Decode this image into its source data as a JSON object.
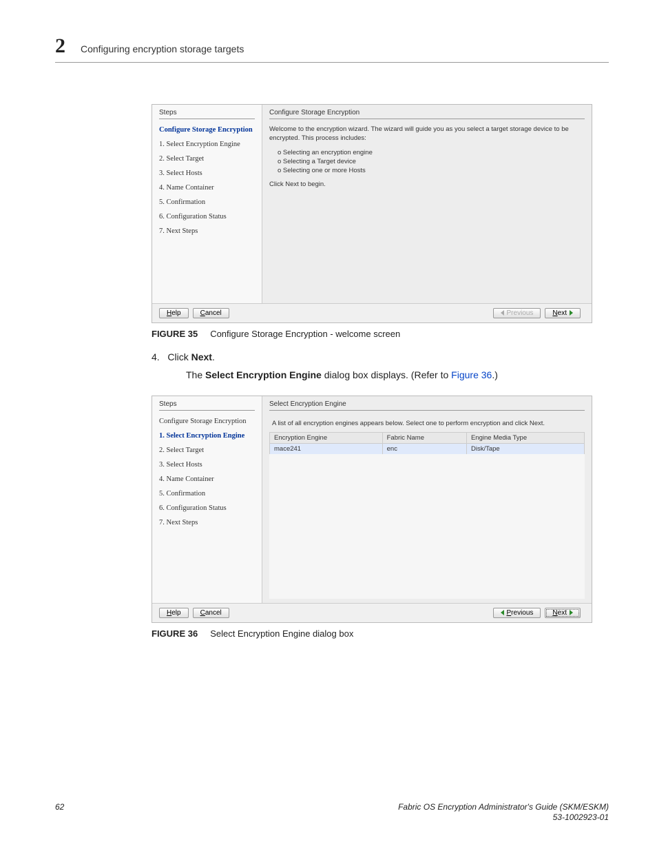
{
  "chapter": {
    "number": "2",
    "title": "Configuring encryption storage targets"
  },
  "screenshot1": {
    "steps_header": "Steps",
    "right_header": "Configure Storage Encryption",
    "steps_title": "Configure Storage Encryption",
    "steps": [
      "1. Select Encryption Engine",
      "2. Select Target",
      "3. Select Hosts",
      "4. Name Container",
      "5. Confirmation",
      "6. Configuration Status",
      "7. Next Steps"
    ],
    "intro": "Welcome to the encryption wizard. The wizard will guide you as you select a target storage device to be encrypted. This process includes:",
    "bullets": [
      "o Selecting an encryption engine",
      "o Selecting a Target device",
      "o Selecting one or more Hosts"
    ],
    "closing": "Click Next to begin.",
    "buttons": {
      "help": "Help",
      "cancel": "Cancel",
      "prev": "Previous",
      "next": "Next"
    }
  },
  "caption1": {
    "label": "FIGURE 35",
    "text": "Configure Storage Encryption - welcome screen"
  },
  "step4": {
    "num": "4.",
    "prefix": "Click ",
    "bold": "Next",
    "suffix": "."
  },
  "step4b": {
    "prefix": "The ",
    "bold": "Select Encryption Engine",
    "mid": " dialog box displays. (Refer to ",
    "link": "Figure 36",
    "suffix": ".)"
  },
  "screenshot2": {
    "steps_header": "Steps",
    "right_header": "Select Encryption Engine",
    "steps_title": "Configure Storage Encryption",
    "current_step": "1. Select Encryption Engine",
    "steps": [
      "2. Select Target",
      "3. Select Hosts",
      "4. Name Container",
      "5. Confirmation",
      "6. Configuration Status",
      "7. Next Steps"
    ],
    "desc": "A list of all encryption engines appears below. Select one to perform encryption and click Next.",
    "table": {
      "headers": [
        "Encryption Engine",
        "Fabric Name",
        "Engine Media Type"
      ],
      "row": [
        "mace241",
        "enc",
        "Disk/Tape"
      ]
    },
    "buttons": {
      "help": "Help",
      "cancel": "Cancel",
      "prev": "Previous",
      "next": "Next"
    }
  },
  "caption2": {
    "label": "FIGURE 36",
    "text": "Select Encryption Engine dialog box"
  },
  "footer": {
    "page": "62",
    "title1": "Fabric OS Encryption Administrator's Guide (SKM/ESKM)",
    "title2": "53-1002923-01"
  }
}
